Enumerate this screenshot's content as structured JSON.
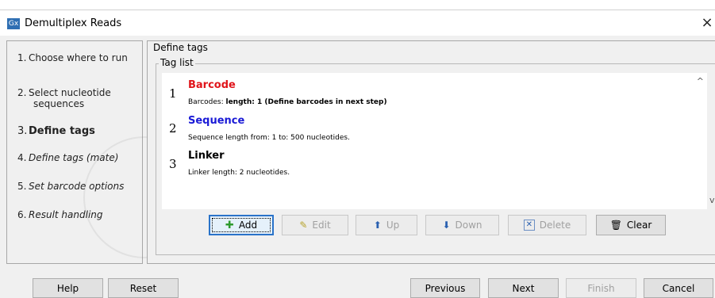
{
  "window": {
    "title": "Demultiplex Reads",
    "icon_text": "Gx",
    "close_label": "×"
  },
  "nav": {
    "items": [
      {
        "num": "1.",
        "label": "Choose where to run"
      },
      {
        "num": "2.",
        "label": "Select nucleotide",
        "label2": "sequences"
      },
      {
        "num": "3.",
        "label": "Define tags"
      },
      {
        "num": "4.",
        "label": "Define tags (mate)"
      },
      {
        "num": "5.",
        "label": "Set barcode options"
      },
      {
        "num": "6.",
        "label": "Result handling"
      }
    ]
  },
  "panel": {
    "title": "Define tags",
    "group_label": "Tag list"
  },
  "tags": [
    {
      "num": "1",
      "name": "Barcode",
      "color": "#e0151b",
      "desc_prefix": "Barcodes: ",
      "desc_bold": "length: 1 (Define barcodes in next step)"
    },
    {
      "num": "2",
      "name": "Sequence",
      "color": "#1a1ad6",
      "desc_prefix": "Sequence length from: 1 to: 500 nucleotides.",
      "desc_bold": ""
    },
    {
      "num": "3",
      "name": "Linker",
      "color": "#000000",
      "desc_prefix": "Linker length: 2 nucleotides.",
      "desc_bold": ""
    }
  ],
  "toolbar": {
    "add": "Add",
    "edit": "Edit",
    "up": "Up",
    "down": "Down",
    "delete": "Delete",
    "clear": "Clear"
  },
  "footer": {
    "help": "Help",
    "reset": "Reset",
    "previous": "Previous",
    "next": "Next",
    "finish": "Finish",
    "cancel": "Cancel"
  },
  "scroll": {
    "up": "^",
    "down": "v"
  }
}
